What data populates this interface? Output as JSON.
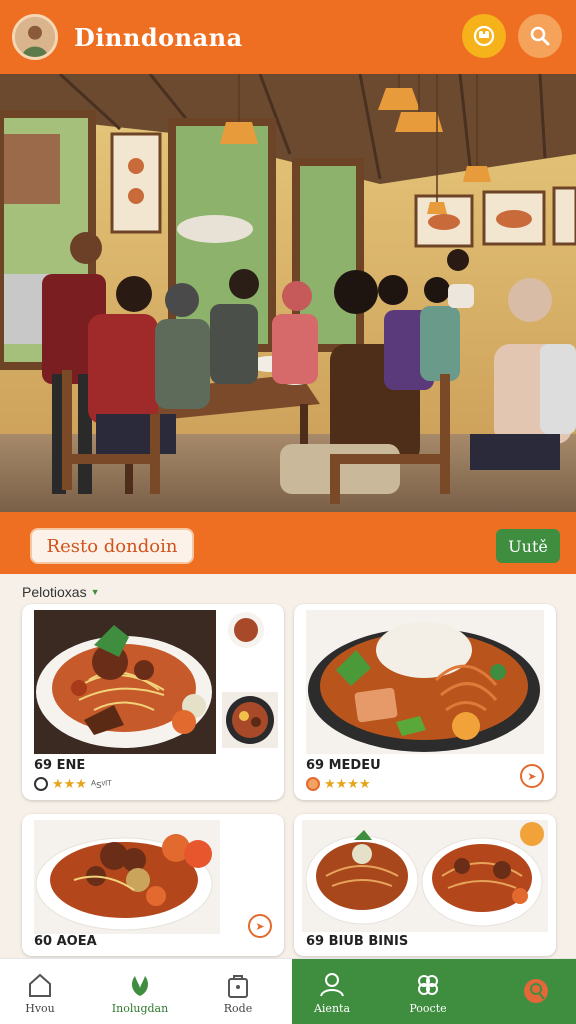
{
  "header": {
    "title": "Dinndonana",
    "avatar_icon": "person-avatar",
    "action_icon": "chef-hat-icon",
    "search_icon": "search-icon"
  },
  "hero": {
    "fab_icons": [
      "plus-icon",
      "share-icon"
    ]
  },
  "banner": {
    "resto_label": "Resto dondoin",
    "unit_label": "Uutě"
  },
  "section": {
    "label": "Pelotioxas"
  },
  "cards": [
    {
      "name": "69 ENE",
      "rating_stars": "★★★",
      "rating_label": "ᴬꜱᵛᴵᵀ"
    },
    {
      "name": "69 MEDEU",
      "rating_stars": "★★★★",
      "rating_label": ""
    },
    {
      "name": "60 AOEA",
      "rating_stars": "",
      "rating_label": ""
    },
    {
      "name": "69 BIUB BINIS",
      "rating_stars": "",
      "rating_label": ""
    }
  ],
  "nav": {
    "items": [
      {
        "label": "Hvou",
        "icon": "home-icon"
      },
      {
        "label": "Inolugdan",
        "icon": "leaf-icon"
      },
      {
        "label": "Rode",
        "icon": "bag-icon"
      },
      {
        "label": "Aienta",
        "icon": "person-icon"
      },
      {
        "label": "Poocte",
        "icon": "clover-icon"
      },
      {
        "label": "",
        "icon": "map-pin-icon"
      }
    ]
  },
  "colors": {
    "primary": "#ef6f22",
    "green": "#3f8e3f",
    "accent": "#f6b21a"
  }
}
